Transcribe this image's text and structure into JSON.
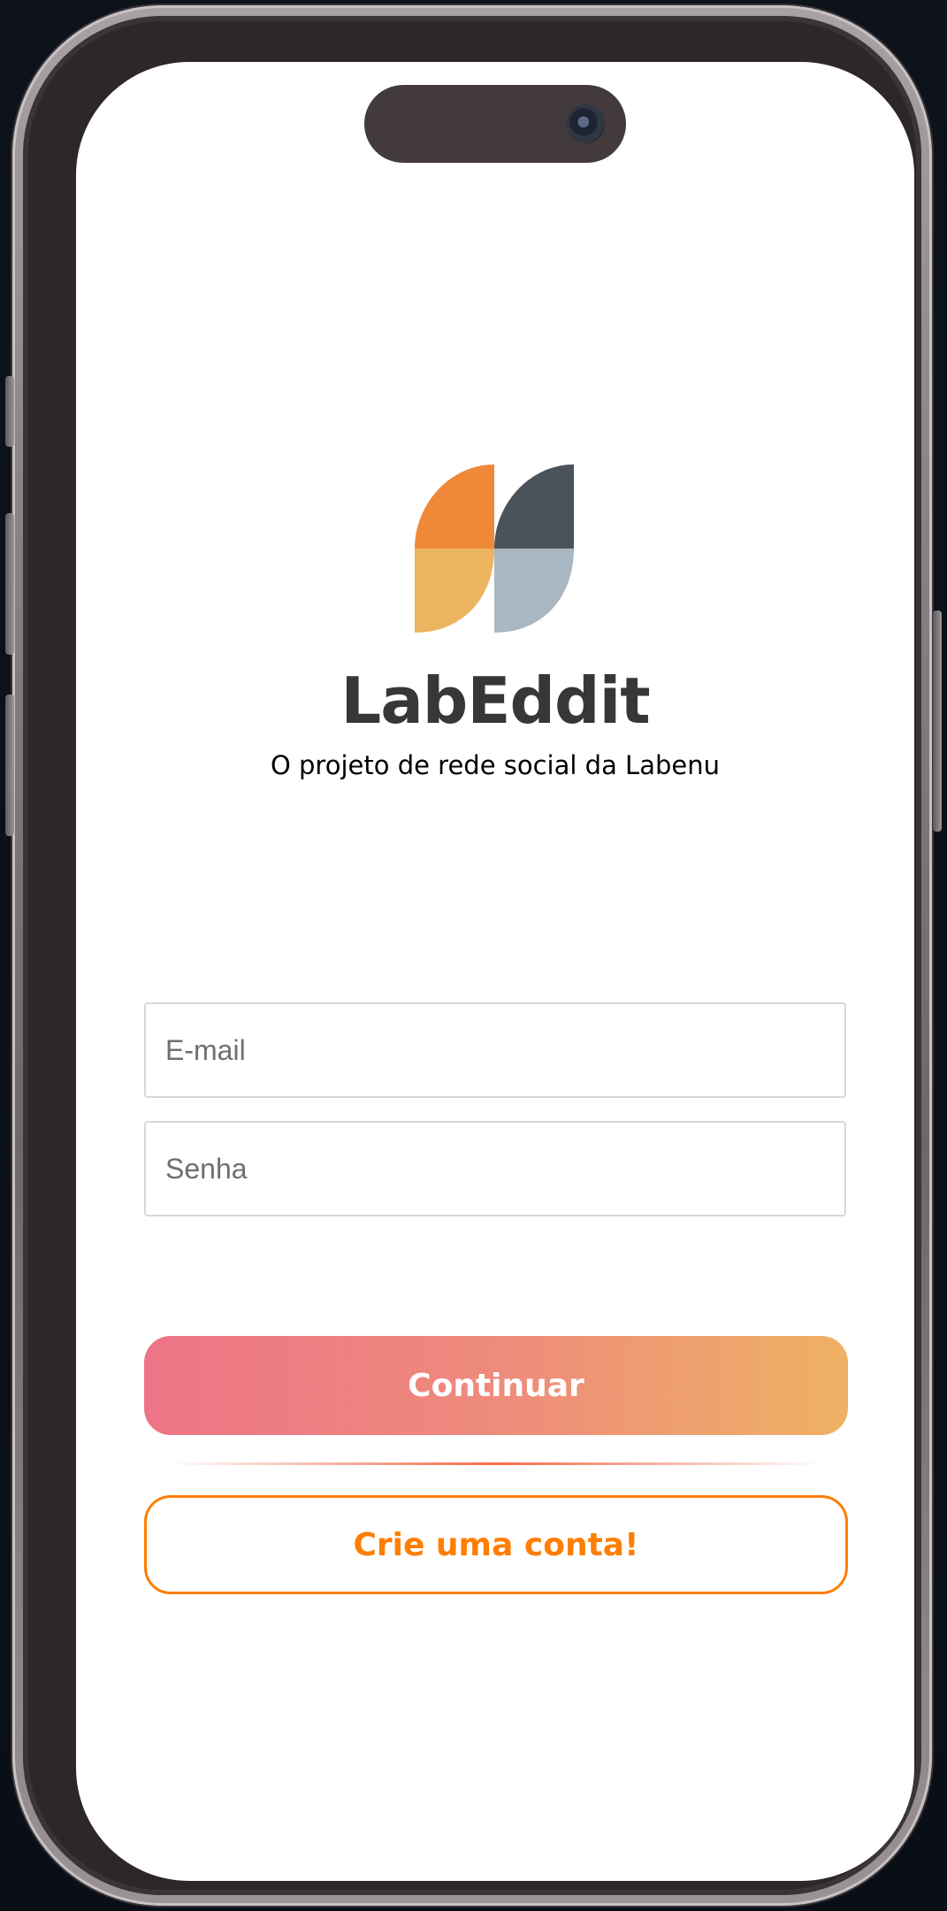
{
  "app": {
    "name": "LabEddit",
    "tagline": "O projeto de rede social da Labenu",
    "logo_icon": "labeddit-logo"
  },
  "login_form": {
    "email": {
      "placeholder": "E-mail",
      "value": ""
    },
    "password": {
      "placeholder": "Senha",
      "value": ""
    },
    "continue_label": "Continuar",
    "signup_label": "Crie uma conta!"
  },
  "colors": {
    "logo_orange": "#F0883A",
    "logo_light_orange": "#ECB45E",
    "logo_dark": "#4A525A",
    "logo_light_blue": "#A9B7C3",
    "primary_gradient_start": "#EE7487",
    "primary_gradient_end": "#EEB164",
    "secondary_accent": "#FE7E02"
  }
}
